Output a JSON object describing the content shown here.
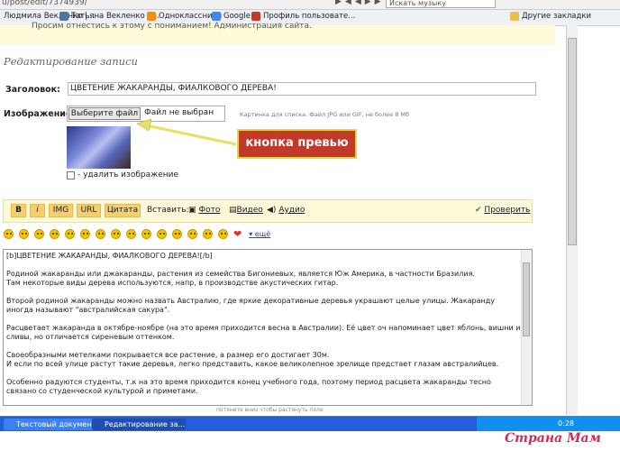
{
  "browser": {
    "url": "u/post/edit/7374939/",
    "search_placeholder": "Искать музыку",
    "bookmarks": [
      "Людмила Векленко |...",
      "Татьяна Векленко | ...",
      "Одноклассники",
      "Google",
      "Профиль пользовате...",
      "Другие закладки"
    ]
  },
  "notice": "Просим отнестись к этому с пониманием! Администрация сайта.",
  "page_title": "Редактирование записи",
  "form": {
    "title_label": "Заголовок:",
    "title_value": "ЦВЕТЕНИЕ ЖАКАРАНДЫ, ФИАЛКОВОГО ДЕРЕВА!",
    "image_label": "Изображение:",
    "file_button": "Выберите файл",
    "file_status": "Файл не выбран",
    "image_hint": "Картинка для списка. Файл JPG или GIF, не более 8 Мб",
    "delete_image": "- удалить изображение"
  },
  "callout": "кнопка превью",
  "toolbar": {
    "bold": "B",
    "italic": "i",
    "img": "IMG",
    "url": "URL",
    "quote": "Цитата",
    "insert_label": "Вставить:",
    "photo": "Фото",
    "video": "Видео",
    "audio": "Аудио",
    "check": "Проверить"
  },
  "smileys_more": "ещё",
  "body_text": "[b]ЦВЕТЕНИЕ ЖАКАРАНДЫ, ФИАЛКОВОГО ДЕРЕВА![/b]\n\nРодиной жакаранды или джакаранды, растения из семейства Бигониевых, является Юж Америка, в частности Бразилия.\nТам некоторые виды дерева используются, напр, в производстве акустических гитар.\n\nВторой родиной жакаранды можно назвать Австралию, где яркие декоративные деревья украшают целые улицы. Жакаранду иногда называют \"австралийская сакура\".\n\nРасцветает жакаранда в октябре-ноябре (на это время приходится весна в Австралии). Её цвет оч напоминает цвет яблонь, вишни и сливы, но отличается сиреневым оттенком.\n\nСвоеобразными метелками покрывается все растение, а размер его достигает 30м.\nИ если по всей улице растут такие деревья, легко представить, какое великолепное зрелище предстает глазам австралийцев.\n\nОсобенно радуются студенты, т.к на это время приходится конец учебного года, поэтому период расцвета жакаранды тесно связано со студенческой культурой и приметами.\n\nНапр, существует поверье: если метёлка жакаранды упадет на голову, то вы пройдете экзамены, есть и др приметы - некоторые суеверные",
  "resize_hint": "потяните вниз чтобы растянуть поле",
  "taskbar": {
    "tasks": [
      "Текстовый докумен...",
      "Редактирование за..."
    ],
    "clock": "0:28"
  },
  "watermark": "Страна Мам",
  "colors": {
    "accent": "#c0392b",
    "toolbar_bg": "#fdf8d8",
    "taskbar": "#245edb"
  }
}
